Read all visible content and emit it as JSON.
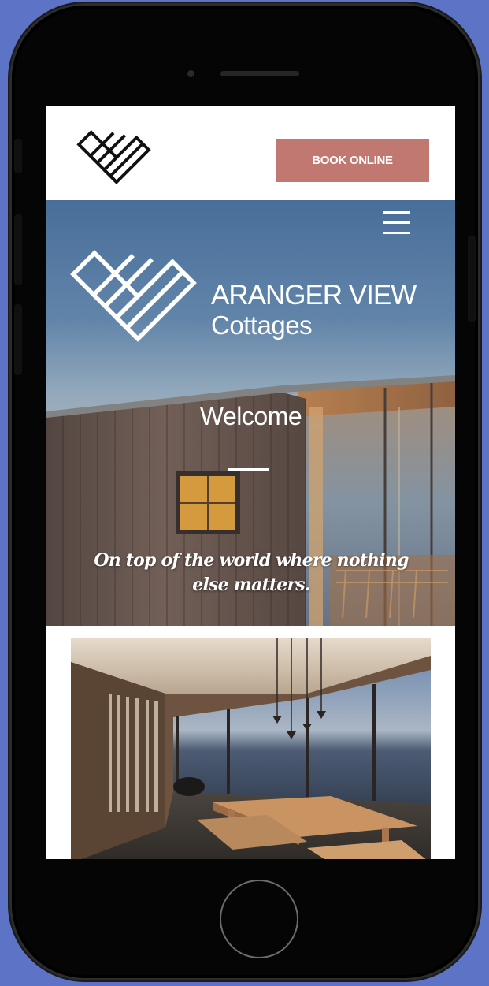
{
  "header": {
    "book_button_label": "BOOK ONLINE"
  },
  "hero": {
    "brand_line1": "ARANGER VIEW",
    "brand_line2": "Cottages",
    "welcome": "Welcome",
    "tagline": "On top of the world where nothing else matters."
  },
  "icons": {
    "logo": "chevron-heart-logo",
    "menu": "hamburger-menu-icon"
  },
  "colors": {
    "book_button": "#c07870",
    "page_background": "#5d74c6",
    "hero_sky": "#4f78a7"
  }
}
